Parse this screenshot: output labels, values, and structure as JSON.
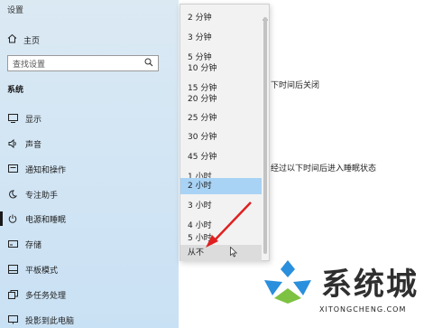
{
  "app_title": "设置",
  "sidebar": {
    "home_label": "主页",
    "search_placeholder": "查找设置",
    "section_title": "系统",
    "items": [
      {
        "label": "显示",
        "icon": "display-icon"
      },
      {
        "label": "声音",
        "icon": "speaker-icon"
      },
      {
        "label": "通知和操作",
        "icon": "notification-icon"
      },
      {
        "label": "专注助手",
        "icon": "moon-icon"
      },
      {
        "label": "电源和睡眠",
        "icon": "power-icon",
        "active": true
      },
      {
        "label": "存储",
        "icon": "storage-icon"
      },
      {
        "label": "平板模式",
        "icon": "tablet-icon"
      },
      {
        "label": "多任务处理",
        "icon": "multitask-icon"
      },
      {
        "label": "投影到此电脑",
        "icon": "project-icon"
      }
    ]
  },
  "content": {
    "screen_off_text": "下时间后关闭",
    "sleep_text": "经过以下时间后进入睡眠状态"
  },
  "dropdown": {
    "options": [
      "2 分钟",
      "3 分钟",
      "5 分钟",
      "10 分钟",
      "15 分钟",
      "20 分钟",
      "25 分钟",
      "30 分钟",
      "45 分钟",
      "1 小时",
      "2 小时",
      "3 小时",
      "4 小时",
      "5 小时",
      "从不"
    ],
    "selected": "2 小时",
    "hovered": "从不"
  },
  "watermark": {
    "text": "系统城",
    "url": "XITONGCHENG.COM",
    "colors": {
      "blue": "#2a8fdc",
      "green": "#7dc242"
    }
  },
  "annotation": {
    "arrow_color": "#e02020"
  }
}
